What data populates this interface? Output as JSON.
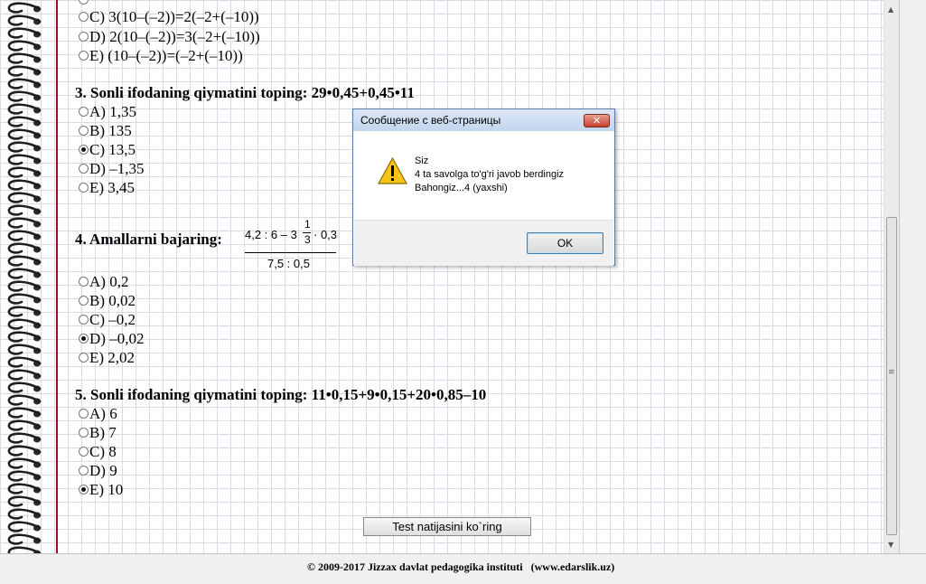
{
  "questions": [
    {
      "options": [
        {
          "text": "C) 3(10–(–2))=2(–2+(–10))",
          "selected": false
        },
        {
          "text": "D) 2(10–(–2))=3(–2+(–10))",
          "selected": false
        },
        {
          "text": "E) (10–(–2))=(–2+(–10))",
          "selected": false
        }
      ]
    },
    {
      "title": "3. Sonli ifodaning qiymatini toping: 29•0,45+0,45•11",
      "options": [
        {
          "text": "A) 1,35",
          "selected": false
        },
        {
          "text": "B) 135",
          "selected": false
        },
        {
          "text": "C) 13,5",
          "selected": true
        },
        {
          "text": "D) –1,35",
          "selected": false
        },
        {
          "text": "E) 3,45",
          "selected": false
        }
      ]
    },
    {
      "title": "4. Amallarni bajaring:",
      "fraction": {
        "numerator_left": "4,2 : 6 – 3",
        "mixed_top": "1",
        "mixed_bottom": "3",
        "numerator_right": "· 0,3",
        "denominator": "7,5 : 0,5"
      },
      "options": [
        {
          "text": "A) 0,2",
          "selected": false
        },
        {
          "text": "B) 0,02",
          "selected": false
        },
        {
          "text": "C) –0,2",
          "selected": false
        },
        {
          "text": "D) –0,02",
          "selected": true
        },
        {
          "text": "E) 2,02",
          "selected": false
        }
      ]
    },
    {
      "title": "5. Sonli ifodaning qiymatini toping: 11•0,15+9•0,15+20•0,85–10",
      "options": [
        {
          "text": "A) 6",
          "selected": false
        },
        {
          "text": "B) 7",
          "selected": false
        },
        {
          "text": "C) 8",
          "selected": false
        },
        {
          "text": "D) 9",
          "selected": false
        },
        {
          "text": "E) 10",
          "selected": true
        }
      ]
    }
  ],
  "test_button_label": "Test natijasini ko`ring",
  "footer": "© 2009-2017 Jizzax davlat pedagogika instituti   (www.edarslik.uz)",
  "dialog": {
    "title": "Сообщение с веб-страницы",
    "close_label": "✕",
    "message_lines": [
      "Siz",
      "4 ta savolga to'g'ri javob berdingiz",
      "Bahongiz...4 (yaxshi)"
    ],
    "ok_label": "OK"
  },
  "scrollbar_glyph": "≡",
  "colors": {
    "margin_line": "#a01020",
    "grid": "#d6dbe6",
    "dialog_border": "#5a7aa6"
  }
}
